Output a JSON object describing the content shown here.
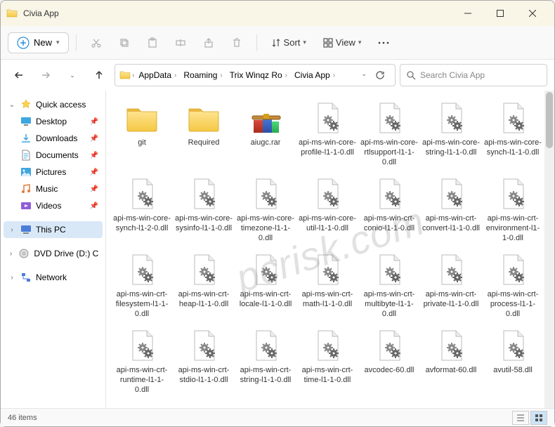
{
  "window": {
    "title": "Civia App"
  },
  "toolbar": {
    "new_label": "New",
    "sort_label": "Sort",
    "view_label": "View"
  },
  "breadcrumb": {
    "segments": [
      "AppData",
      "Roaming",
      "Trix Winqz Ro",
      "Civia App"
    ]
  },
  "search": {
    "placeholder": "Search Civia App"
  },
  "sidebar": {
    "quick_access": "Quick access",
    "desktop": "Desktop",
    "downloads": "Downloads",
    "documents": "Documents",
    "pictures": "Pictures",
    "music": "Music",
    "videos": "Videos",
    "this_pc": "This PC",
    "dvd": "DVD Drive (D:) CCCC",
    "network": "Network"
  },
  "items": [
    {
      "type": "folder",
      "name": "git"
    },
    {
      "type": "folder",
      "name": "Required"
    },
    {
      "type": "rar",
      "name": "aiugc.rar"
    },
    {
      "type": "dll",
      "name": "api-ms-win-core-profile-l1-1-0.dll"
    },
    {
      "type": "dll",
      "name": "api-ms-win-core-rtlsupport-l1-1-0.dll"
    },
    {
      "type": "dll",
      "name": "api-ms-win-core-string-l1-1-0.dll"
    },
    {
      "type": "dll",
      "name": "api-ms-win-core-synch-l1-1-0.dll"
    },
    {
      "type": "dll",
      "name": "api-ms-win-core-synch-l1-2-0.dll"
    },
    {
      "type": "dll",
      "name": "api-ms-win-core-sysinfo-l1-1-0.dll"
    },
    {
      "type": "dll",
      "name": "api-ms-win-core-timezone-l1-1-0.dll"
    },
    {
      "type": "dll",
      "name": "api-ms-win-core-util-l1-1-0.dll"
    },
    {
      "type": "dll",
      "name": "api-ms-win-crt-conio-l1-1-0.dll"
    },
    {
      "type": "dll",
      "name": "api-ms-win-crt-convert-l1-1-0.dll"
    },
    {
      "type": "dll",
      "name": "api-ms-win-crt-environment-l1-1-0.dll"
    },
    {
      "type": "dll",
      "name": "api-ms-win-crt-filesystem-l1-1-0.dll"
    },
    {
      "type": "dll",
      "name": "api-ms-win-crt-heap-l1-1-0.dll"
    },
    {
      "type": "dll",
      "name": "api-ms-win-crt-locale-l1-1-0.dll"
    },
    {
      "type": "dll",
      "name": "api-ms-win-crt-math-l1-1-0.dll"
    },
    {
      "type": "dll",
      "name": "api-ms-win-crt-multibyte-l1-1-0.dll"
    },
    {
      "type": "dll",
      "name": "api-ms-win-crt-private-l1-1-0.dll"
    },
    {
      "type": "dll",
      "name": "api-ms-win-crt-process-l1-1-0.dll"
    },
    {
      "type": "dll",
      "name": "api-ms-win-crt-runtime-l1-1-0.dll"
    },
    {
      "type": "dll",
      "name": "api-ms-win-crt-stdio-l1-1-0.dll"
    },
    {
      "type": "dll",
      "name": "api-ms-win-crt-string-l1-1-0.dll"
    },
    {
      "type": "dll",
      "name": "api-ms-win-crt-time-l1-1-0.dll"
    },
    {
      "type": "dll",
      "name": "avcodec-60.dll"
    },
    {
      "type": "dll",
      "name": "avformat-60.dll"
    },
    {
      "type": "dll",
      "name": "avutil-58.dll"
    }
  ],
  "status": {
    "count": "46 items"
  },
  "watermark": "pcrisk.com"
}
